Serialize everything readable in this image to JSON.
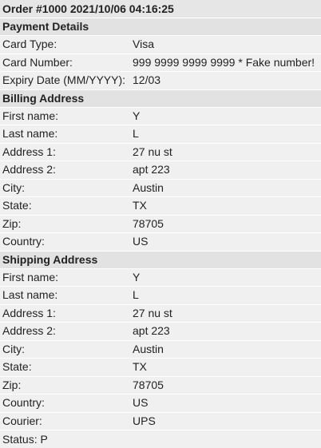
{
  "order_title": "Order #1000 2021/10/06 04:16:25",
  "payment": {
    "header": "Payment Details",
    "rows": [
      {
        "label": "Card Type:",
        "value": "Visa"
      },
      {
        "label": "Card Number:",
        "value": "999 9999 9999 9999 * Fake number!"
      },
      {
        "label": "Expiry Date (MM/YYYY):",
        "value": "12/03"
      }
    ]
  },
  "billing": {
    "header": "Billing Address",
    "rows": [
      {
        "label": "First name:",
        "value": "Y"
      },
      {
        "label": "Last name:",
        "value": "L"
      },
      {
        "label": "Address 1:",
        "value": "27 nu st"
      },
      {
        "label": "Address 2:",
        "value": "apt 223"
      },
      {
        "label": "City:",
        "value": "Austin"
      },
      {
        "label": "State:",
        "value": "TX"
      },
      {
        "label": "Zip:",
        "value": "78705"
      },
      {
        "label": "Country:",
        "value": "US"
      }
    ]
  },
  "shipping": {
    "header": "Shipping Address",
    "rows": [
      {
        "label": "First name:",
        "value": "Y"
      },
      {
        "label": "Last name:",
        "value": "L"
      },
      {
        "label": "Address 1:",
        "value": "27 nu st"
      },
      {
        "label": "Address 2:",
        "value": "apt 223"
      },
      {
        "label": "City:",
        "value": "Austin"
      },
      {
        "label": "State:",
        "value": "TX"
      },
      {
        "label": "Zip:",
        "value": "78705"
      },
      {
        "label": "Country:",
        "value": "US"
      },
      {
        "label": "Courier:",
        "value": "UPS"
      }
    ]
  },
  "status": "Status: P"
}
